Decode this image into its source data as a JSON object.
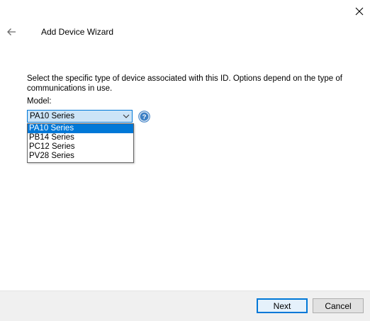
{
  "window": {
    "title": "Add Device Wizard",
    "close_icon": "close-icon",
    "back_icon": "back-arrow-icon"
  },
  "content": {
    "instructions": "Select the specific type of device associated with this ID. Options depend on the type of communications in use.",
    "model_label": "Model:",
    "model_selected": "PA10 Series",
    "model_options": [
      "PA10 Series",
      "PB14 Series",
      "PC12 Series",
      "PV28 Series"
    ],
    "help_icon": "help-icon"
  },
  "footer": {
    "next_label": "Next",
    "cancel_label": "Cancel"
  },
  "colors": {
    "accent": "#0078d7",
    "select_bg": "#cce4f7",
    "help_icon": "#3c7fc4",
    "footer_bg": "#f0f0f0"
  }
}
